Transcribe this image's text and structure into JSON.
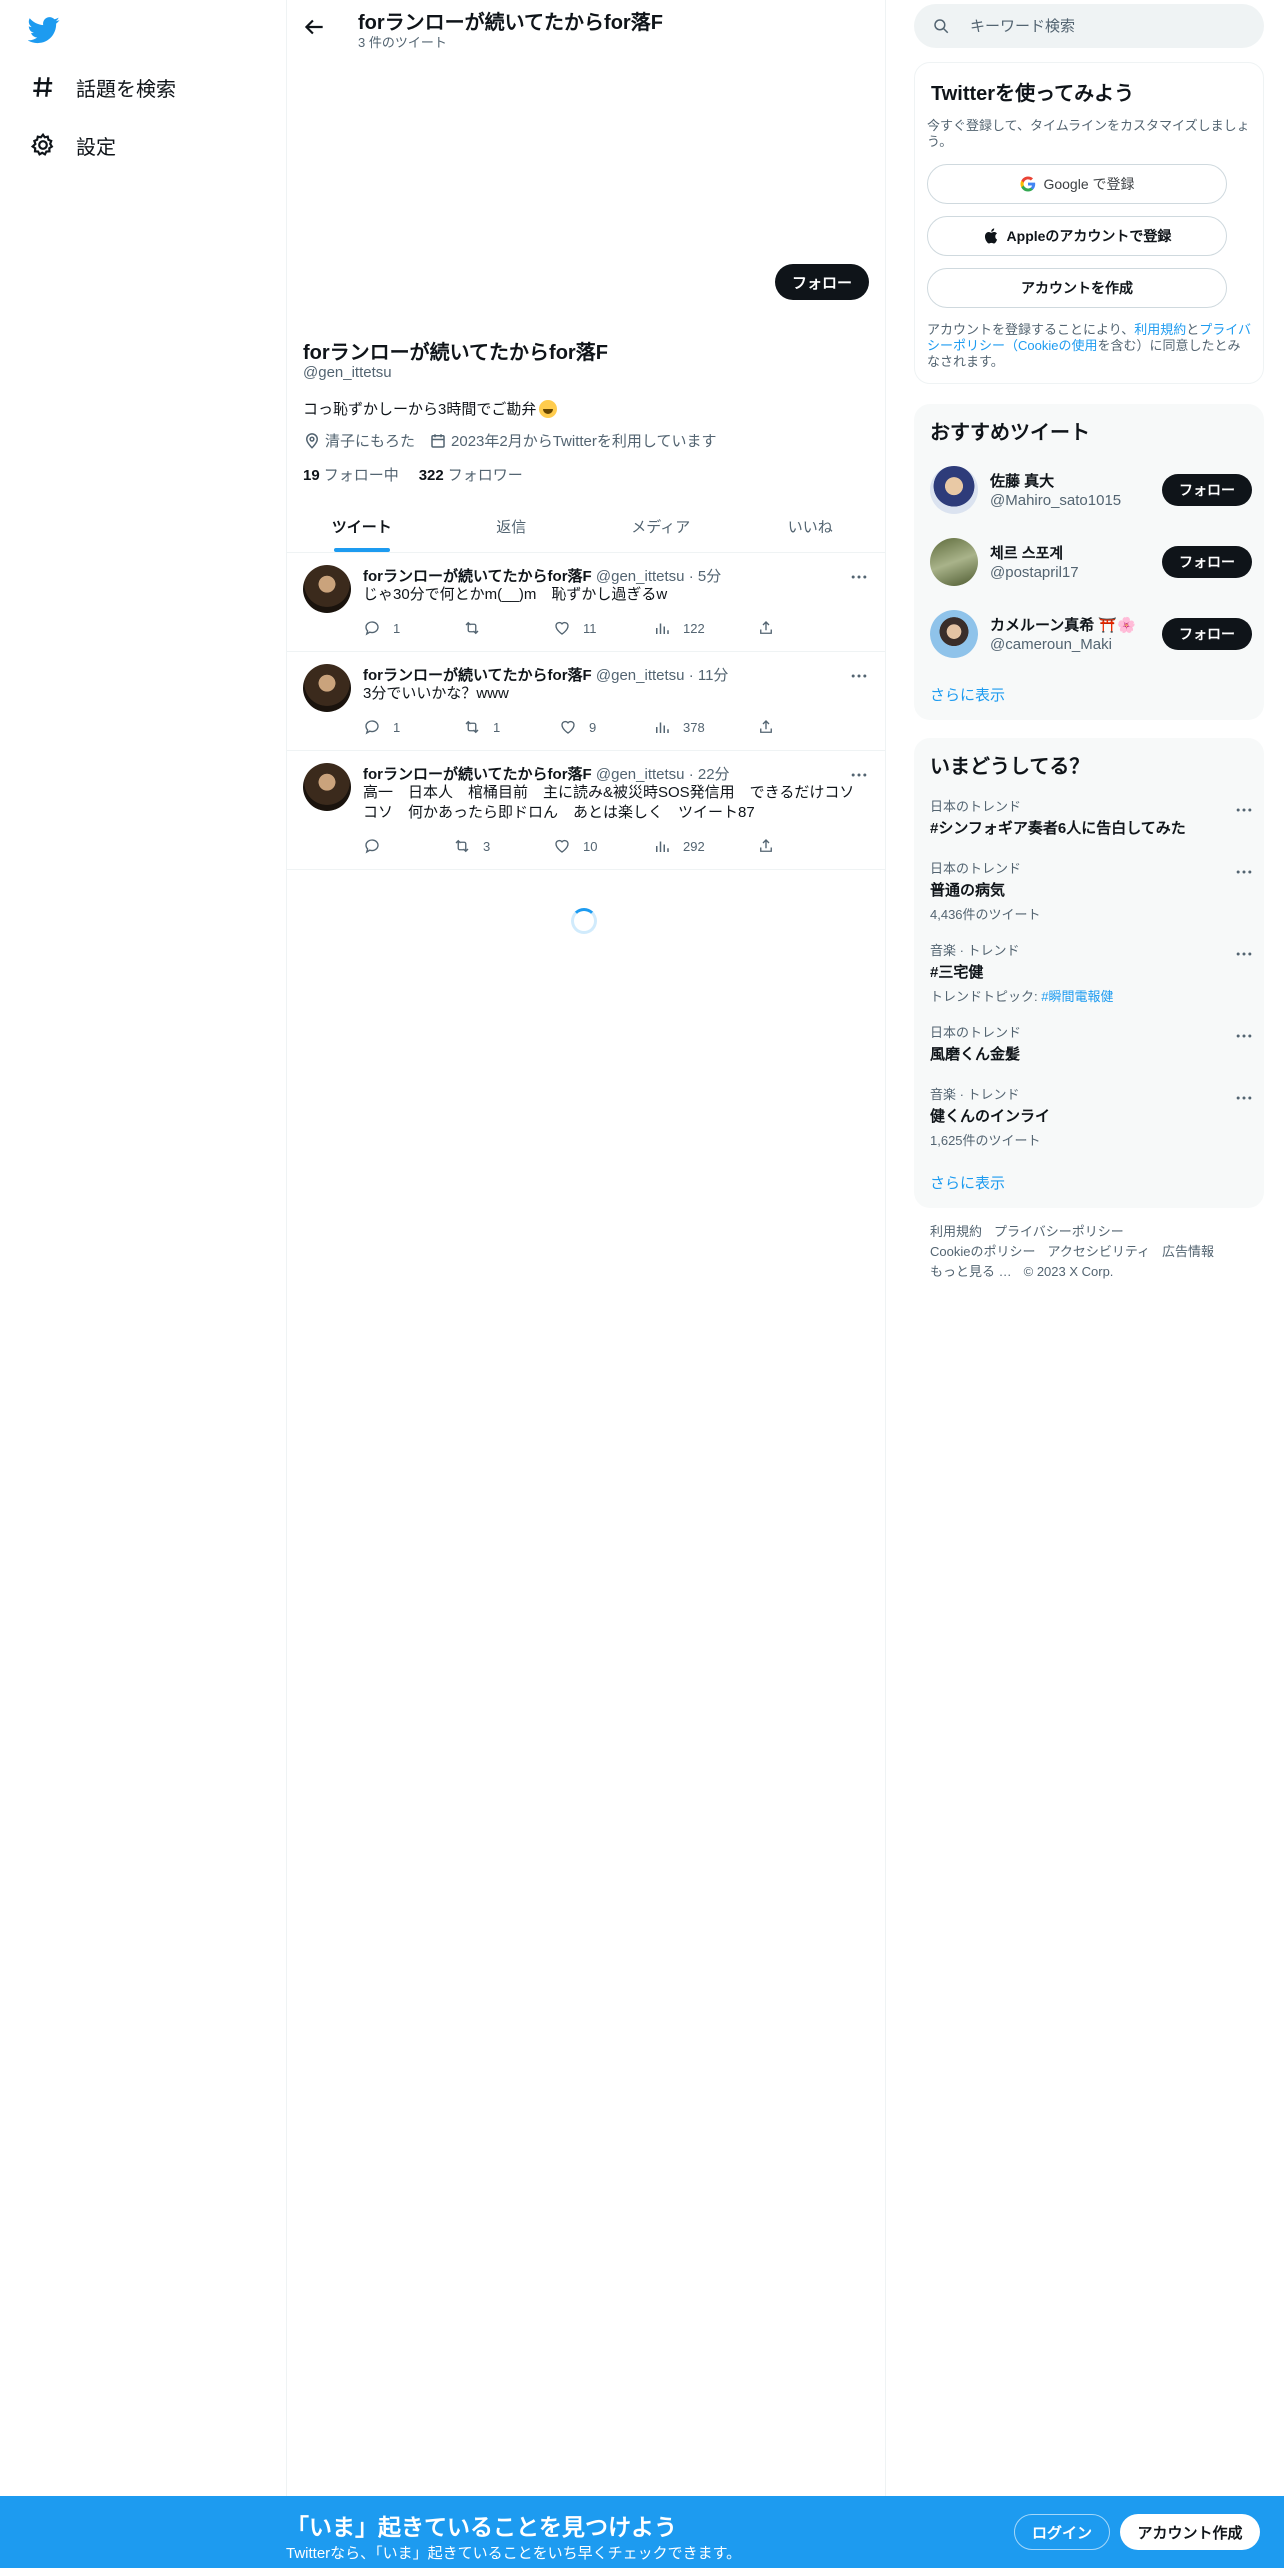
{
  "nav": {
    "items": [
      {
        "label": "話題を検索",
        "icon": "hashtag-icon"
      },
      {
        "label": "設定",
        "icon": "gear-icon"
      }
    ]
  },
  "header": {
    "title": "forランローが続いてたからfor落F",
    "subtitle": "3 件のツイート"
  },
  "profile": {
    "follow_label": "フォロー",
    "name": "forランローが続いてたからfor落F",
    "handle": "@gen_ittetsu",
    "bio": "コっ恥ずかしーから3時間でご勘弁",
    "location": "清子にもろた",
    "joined": "2023年2月からTwitterを利用しています",
    "following_count": "19",
    "following_label": "フォロー中",
    "followers_count": "322",
    "followers_label": "フォロワー"
  },
  "tabs": [
    "ツイート",
    "返信",
    "メディア",
    "いいね"
  ],
  "tweets": [
    {
      "name": "forランローが続いてたからfor落F",
      "handle": "@gen_ittetsu",
      "time": "5分",
      "text": "じゃ30分で何とかm(__)m　恥ずかし過ぎるw",
      "replies": "1",
      "retweets": "",
      "likes": "11",
      "views": "122"
    },
    {
      "name": "forランローが続いてたからfor落F",
      "handle": "@gen_ittetsu",
      "time": "11分",
      "text": "3分でいいかな？www",
      "replies": "1",
      "retweets": "1",
      "likes": "9",
      "views": "378"
    },
    {
      "name": "forランローが続いてたからfor落F",
      "handle": "@gen_ittetsu",
      "time": "22分",
      "text": "高一　日本人　棺桶目前　主に読み&被災時SOS発信用　できるだけコソコソ　何かあったら即ドロん　あとは楽しく　ツイート87",
      "replies": "",
      "retweets": "3",
      "likes": "10",
      "views": "292"
    }
  ],
  "search": {
    "placeholder": "キーワード検索"
  },
  "signup": {
    "title": "Twitterを使ってみよう",
    "subtitle": "今すぐ登録して、タイムラインをカスタマイズしましょう。",
    "google": "Google で登録",
    "apple": "Appleのアカウントで登録",
    "create": "アカウントを作成",
    "legal_pre": "アカウントを登録することにより、",
    "legal_terms": "利用規約",
    "legal_and": "と",
    "legal_privacy": "プライバシーポリシー（Cookieの使用",
    "legal_post": "を含む）に同意したとみなされます。"
  },
  "who_to_follow": {
    "title": "おすすめツイート",
    "users": [
      {
        "name": "佐藤 真大",
        "handle": "@Mahiro_sato1015",
        "follow": "フォロー"
      },
      {
        "name": "체르 스포계",
        "handle": "@postapril17",
        "follow": "フォロー"
      },
      {
        "name": "カメルーン真希 ⛩️🌸",
        "handle": "@cameroun_Maki",
        "follow": "フォロー"
      }
    ],
    "more": "さらに表示"
  },
  "trends": {
    "title": "いまどうしてる？",
    "items": [
      {
        "context": "日本のトレンド",
        "name": "#シンフォギア奏者6人に告白してみた",
        "extra": ""
      },
      {
        "context": "日本のトレンド",
        "name": "普通の病気",
        "extra": "4,436件のツイート"
      },
      {
        "context": "音楽 · トレンド",
        "name": "#三宅健",
        "extra_pre": "トレンドトピック: ",
        "extra_link": "#瞬間電報健"
      },
      {
        "context": "日本のトレンド",
        "name": "風磨くん金髪",
        "extra": ""
      },
      {
        "context": "音楽 · トレンド",
        "name": "健くんのインライ",
        "extra": "1,625件のツイート"
      }
    ],
    "more": "さらに表示"
  },
  "footer": {
    "links": [
      "利用規約",
      "プライバシーポリシー",
      "Cookieのポリシー",
      "アクセシビリティ",
      "広告情報",
      "もっと見る …"
    ],
    "copyright": "© 2023 X Corp."
  },
  "bottom": {
    "title": "「いま」起きていることを見つけよう",
    "subtitle": "Twitterなら、「いま」起きていることをいち早くチェックできます。",
    "login": "ログイン",
    "signup": "アカウント作成"
  },
  "colors": {
    "accent": "#1d9bf0",
    "text": "#0f1419",
    "muted": "#536471",
    "border": "#eff3f4"
  }
}
